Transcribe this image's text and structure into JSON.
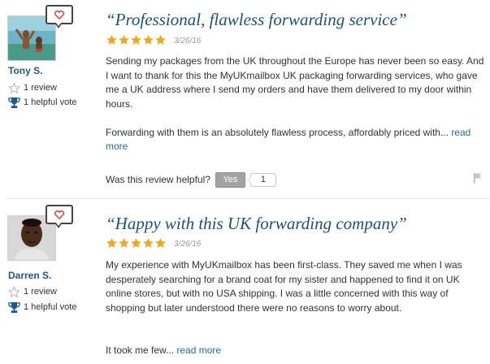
{
  "reviews": [
    {
      "reviewer": {
        "name": "Tony S.",
        "reviews": "1 review",
        "helpful_votes": "1 helpful vote"
      },
      "title": "“Professional, flawless forwarding service”",
      "rating": 5,
      "date": "3/26/16",
      "paragraphs": [
        "Sending my packages from the UK throughout the Europe has never been so easy. And I want to thank for this the MyUKmailbox UK packaging forwarding services, who gave me a UK address where I send my orders and have them delivered to my door within hours.",
        "Forwarding with them is an absolutely flawless process, affordably priced with..."
      ],
      "read_more": "read more",
      "helpful_prompt": "Was this review helpful?",
      "yes_label": "Yes",
      "yes_count": "1"
    },
    {
      "reviewer": {
        "name": "Darren S.",
        "reviews": "1 review",
        "helpful_votes": "1 helpful vote"
      },
      "title": "“Happy with this UK forwarding company”",
      "rating": 5,
      "date": "3/26/16",
      "paragraphs": [
        "My experience with MyUKmailbox has been first-class. They saved me when I was desperately searching for a brand coat for my sister and happened to find it on UK online stores, but with no USA shipping. I was a little concerned with this way of shopping but later understood there were no reasons to worry about.",
        "It took me few..."
      ],
      "read_more": "read more"
    }
  ],
  "colors": {
    "star": "#f0a81e",
    "title": "#1f4f7e",
    "link": "#1f6fa8",
    "trophy": "#1f5a8c"
  }
}
